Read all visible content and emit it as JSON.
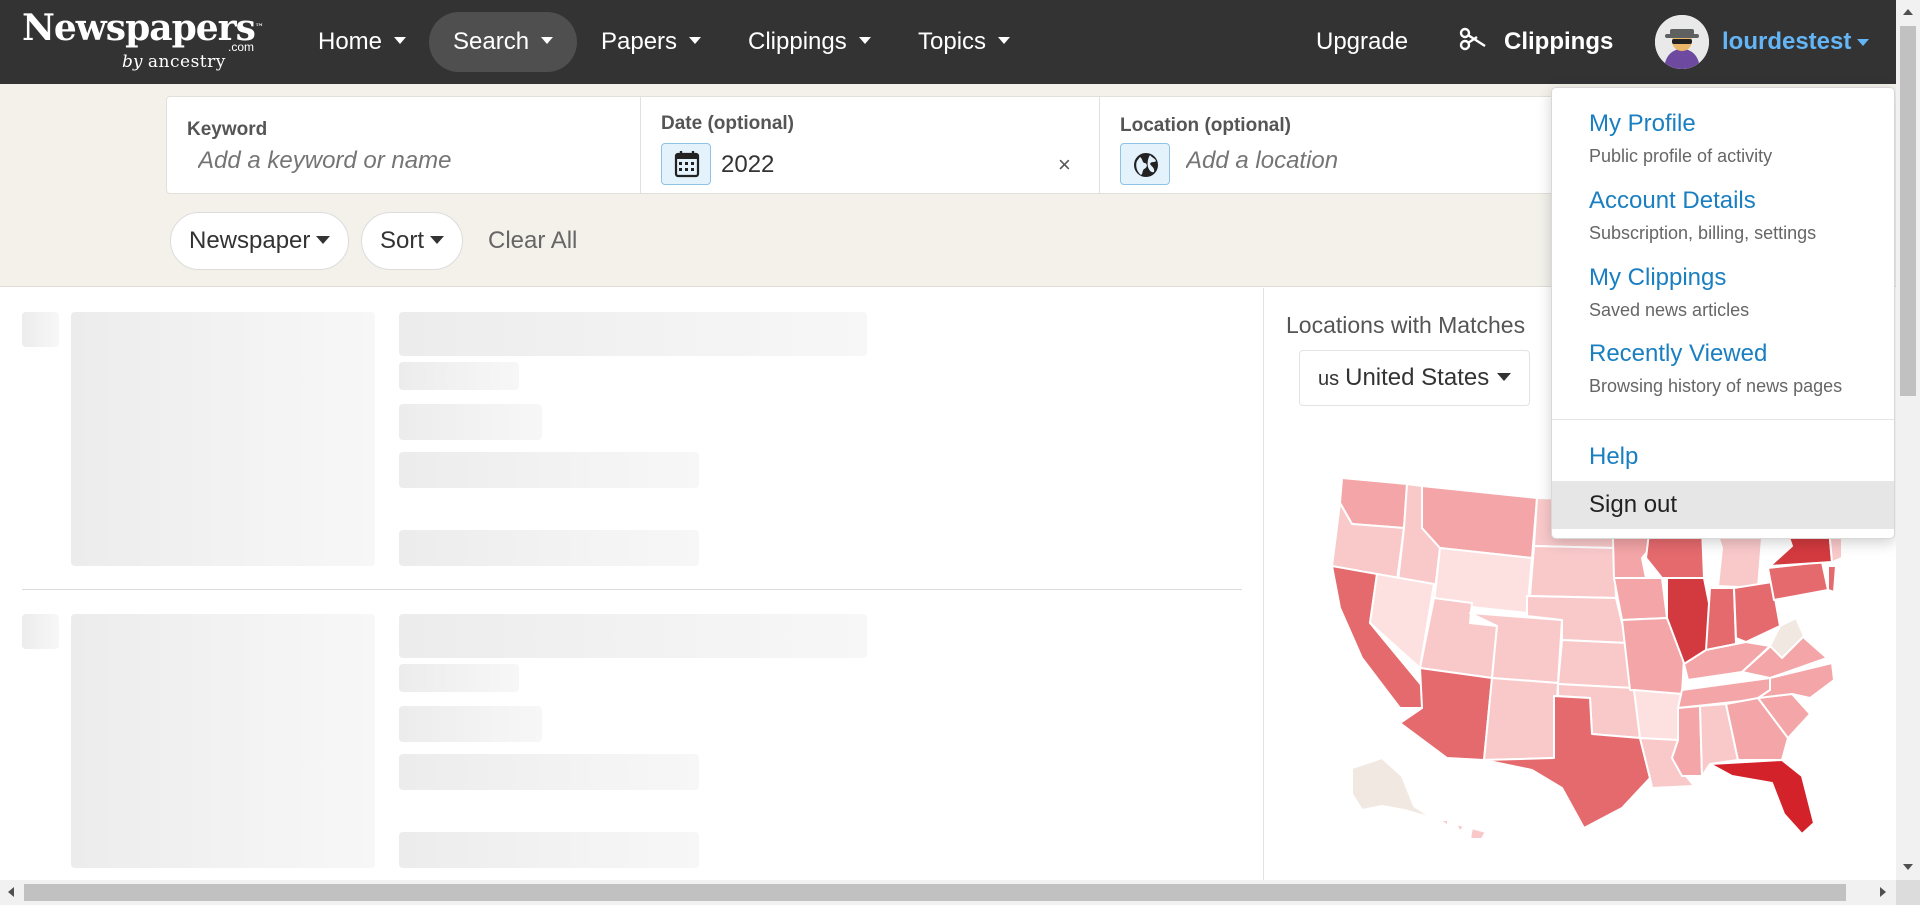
{
  "logo": {
    "word": "Newspapers",
    "tm": "™",
    "com": ".com",
    "by": "by",
    "partner": "ancestry"
  },
  "nav": {
    "items": [
      {
        "label": "Home"
      },
      {
        "label": "Search"
      },
      {
        "label": "Papers"
      },
      {
        "label": "Clippings"
      },
      {
        "label": "Topics"
      }
    ],
    "upgrade": "Upgrade",
    "clippings": "Clippings",
    "username": "lourdestest"
  },
  "search": {
    "keyword_label": "Keyword",
    "keyword_placeholder": "Add a keyword or name",
    "date_label": "Date (optional)",
    "date_value": "2022",
    "date_clear": "×",
    "location_label": "Location (optional)",
    "location_placeholder": "Add a location"
  },
  "filters": {
    "newspaper": "Newspaper",
    "sort": "Sort",
    "clear_all": "Clear All"
  },
  "locations": {
    "title": "Locations with Matches",
    "country_code": "us",
    "country": "United States"
  },
  "dropdown": {
    "items": [
      {
        "title": "My Profile",
        "sub": "Public profile of activity"
      },
      {
        "title": "Account Details",
        "sub": "Subscription, billing, settings"
      },
      {
        "title": "My Clippings",
        "sub": "Saved news articles"
      },
      {
        "title": "Recently Viewed",
        "sub": "Browsing history of news pages"
      }
    ],
    "help": "Help",
    "signout": "Sign out"
  },
  "colors": {
    "nav_bg": "#333333",
    "link_blue": "#1a7fc1",
    "username_blue": "#64b5f6",
    "band_bg": "#f3f1ea",
    "map_light": "#f9c9ca",
    "map_mid": "#f3a5a7",
    "map_high": "#e56a6e",
    "map_top": "#d32229"
  },
  "icons": [
    "calendar-icon",
    "globe-icon",
    "scissors-icon",
    "avatar-spy-icon"
  ]
}
